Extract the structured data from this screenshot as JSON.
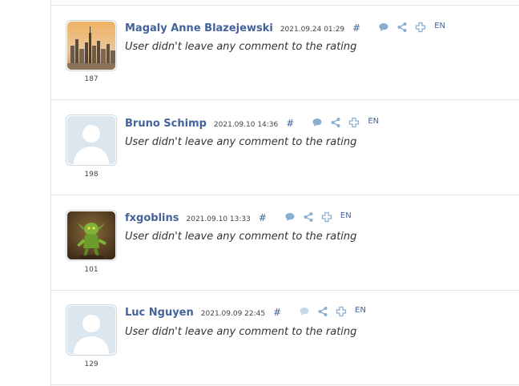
{
  "reviews": [
    {
      "author": "Magaly Anne Blazejewski",
      "date": "2021.09.24 01:29",
      "hash": "#",
      "lang": "EN",
      "comment": "User didn't leave any comment to the rating",
      "rating_count": "187",
      "avatar": "city-skyline-photo"
    },
    {
      "author": "Bruno Schimp",
      "date": "2021.09.10 14:36",
      "hash": "#",
      "lang": "EN",
      "comment": "User didn't leave any comment to the rating",
      "rating_count": "198",
      "avatar": "default-user-silhouette"
    },
    {
      "author": "fxgoblins",
      "date": "2021.09.10 13:33",
      "hash": "#",
      "lang": "EN",
      "comment": "User didn't leave any comment to the rating",
      "rating_count": "101",
      "avatar": "goblin-creature-image"
    },
    {
      "author": "Luc Nguyen",
      "date": "2021.09.09 22:45",
      "hash": "#",
      "lang": "EN",
      "comment": "User didn't leave any comment to the rating",
      "rating_count": "129",
      "avatar": "default-user-silhouette"
    }
  ],
  "icons": [
    "comment-icon",
    "share-icon",
    "plus-icon"
  ],
  "colors": {
    "link": "#42639a",
    "icon": "#8aaed0",
    "border": "#e2e2e2",
    "text": "#333333"
  }
}
